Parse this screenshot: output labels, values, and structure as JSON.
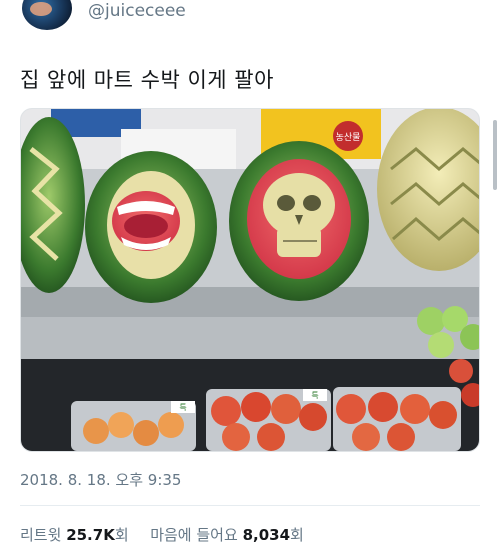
{
  "header": {
    "handle": "@juiceceee"
  },
  "tweet": {
    "text": "집 앞에 마트 수박 이게 팔아"
  },
  "photo": {
    "price_sign": "농산물",
    "labels": [
      "특",
      "특"
    ]
  },
  "meta": {
    "timestamp": "2018. 8. 18. 오후 9:35"
  },
  "stats": {
    "retweet_label": "리트윗",
    "retweet_count": "25.7K",
    "retweet_unit": "회",
    "like_label": "마음에 들어요",
    "like_count": "8,034",
    "like_unit": "회"
  },
  "colors": {
    "text": "#14171a",
    "secondary": "#657786",
    "divider": "#e6ecf0"
  }
}
